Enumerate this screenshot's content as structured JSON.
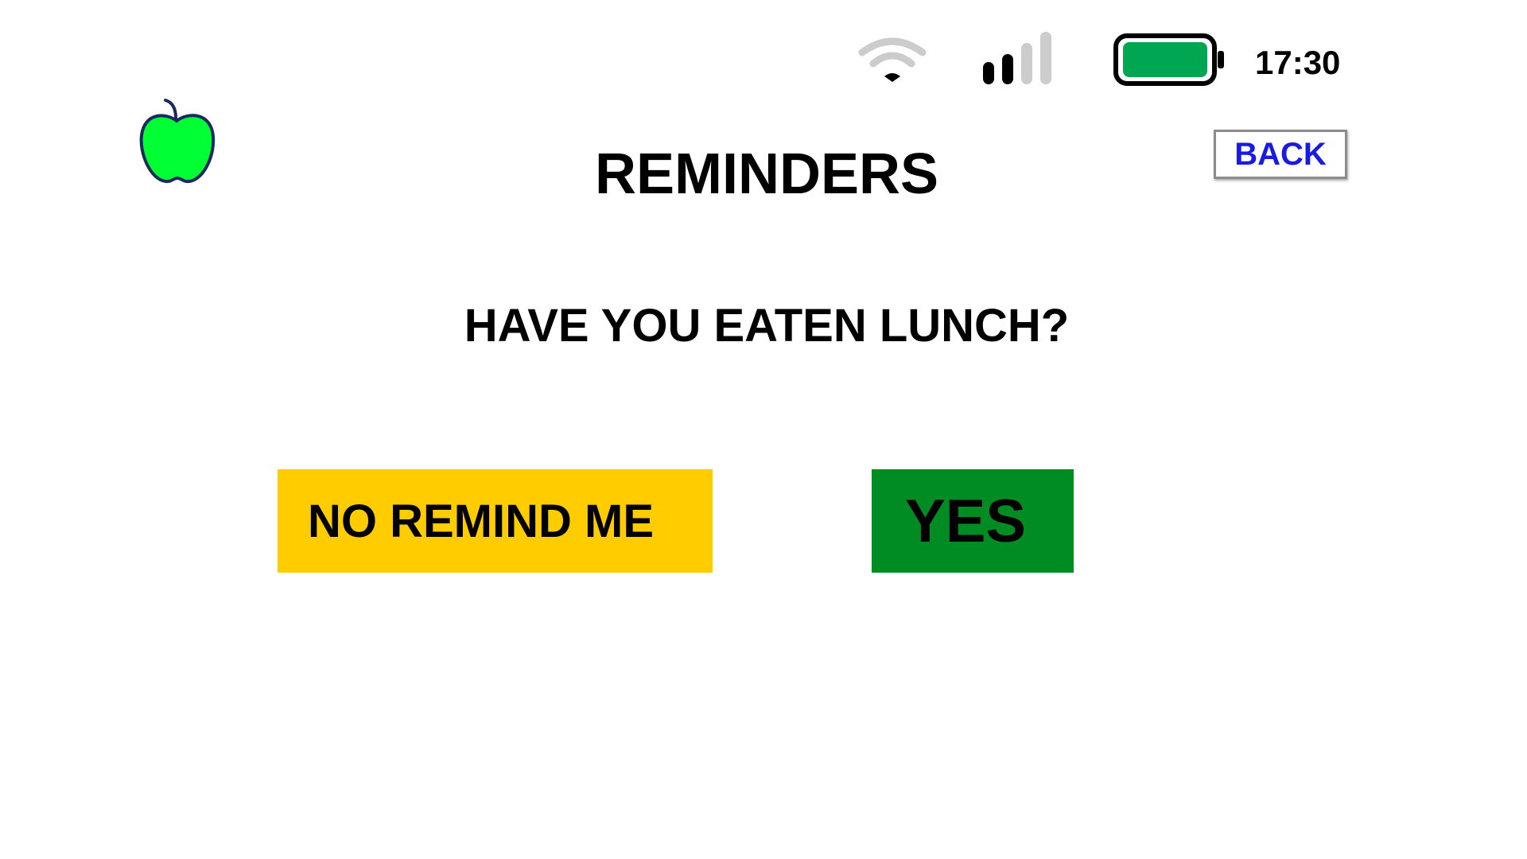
{
  "status_bar": {
    "time": "17:30",
    "wifi_icon": "wifi-icon",
    "signal_icon": "cellular-signal-icon",
    "signal_level": "2 of 4",
    "battery_icon": "battery-icon",
    "battery_level": 1.0,
    "battery_color": "#00a651"
  },
  "header": {
    "logo_icon": "green-apple-icon",
    "logo_color": "#00ff33",
    "title": "REMINDERS",
    "back_label": "BACK",
    "back_color": "#1a1ae6"
  },
  "prompt": {
    "question": "HAVE YOU EATEN LUNCH?"
  },
  "actions": {
    "no_label": "NO REMIND ME",
    "no_color": "#ffcc00",
    "yes_label": "YES",
    "yes_color": "#008c22"
  }
}
